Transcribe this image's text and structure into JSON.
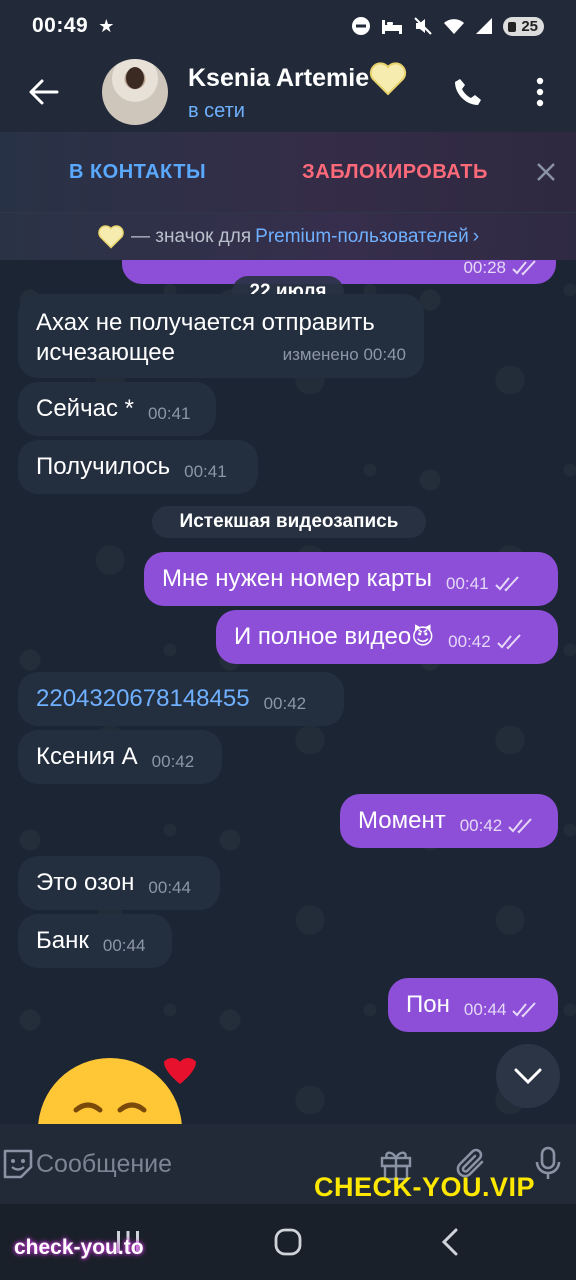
{
  "status_bar": {
    "time": "00:49",
    "star": "★",
    "battery": "25"
  },
  "header": {
    "name": "Ksenia Artemie",
    "status": "в сети"
  },
  "action_bar": {
    "add_contact": "В КОНТАКТЫ",
    "block": "ЗАБЛОКИРОВАТЬ"
  },
  "premium": {
    "text": "— значок для",
    "link": "Premium-пользователей",
    "chevron": "›"
  },
  "chat": {
    "prev_time": "00:28",
    "date": "22 июля",
    "expired_label": "Истекшая видеозапись",
    "messages": [
      {
        "dir": "in",
        "text1": "Ахах не получается отправить",
        "text2": "исчезающее",
        "edited": "изменено",
        "time": "00:40"
      },
      {
        "dir": "in",
        "text": "Сейчас *",
        "time": "00:41"
      },
      {
        "dir": "in",
        "text": "Получилось",
        "time": "00:41"
      },
      {
        "dir": "out",
        "text": "Мне нужен номер карты",
        "time": "00:41"
      },
      {
        "dir": "out",
        "text": "И полное видео",
        "emoji": "😈",
        "time": "00:42"
      },
      {
        "dir": "in",
        "text": "2204320678148455",
        "time": "00:42"
      },
      {
        "dir": "in",
        "text": "Ксения А",
        "time": "00:42"
      },
      {
        "dir": "out",
        "text": "Момент",
        "time": "00:42"
      },
      {
        "dir": "in",
        "text": "Это озон",
        "time": "00:44"
      },
      {
        "dir": "in",
        "text": "Банк",
        "time": "00:44"
      },
      {
        "dir": "out",
        "text": "Пон",
        "time": "00:44"
      }
    ]
  },
  "input": {
    "placeholder": "Сообщение"
  },
  "watermarks": {
    "yellow": "CHECK-YOU.VIP",
    "bottom": "check-you.to"
  },
  "colors": {
    "accent_blue": "#5aa9ff",
    "block_red": "#ff6a7a",
    "outgoing_bubble": "#8d4fd8",
    "incoming_bubble": "#232e3f"
  }
}
